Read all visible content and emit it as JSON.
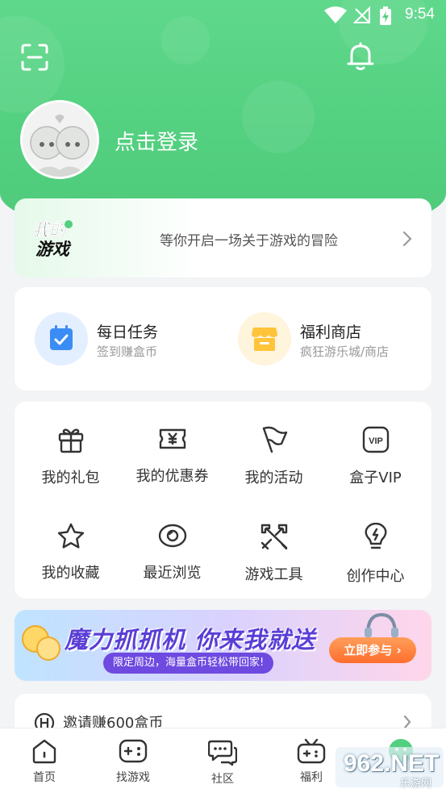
{
  "status_bar": {
    "time": "9:54"
  },
  "profile": {
    "login_text": "点击登录"
  },
  "adventure": {
    "logo_text_1": "我的",
    "logo_text_2": "游戏",
    "text": "等你开启一场关于游戏的冒险"
  },
  "tasks": [
    {
      "title": "每日任务",
      "subtitle": "签到赚盒币",
      "icon": "calendar-check-icon"
    },
    {
      "title": "福利商店",
      "subtitle": "疯狂游乐城/商店",
      "icon": "shop-icon"
    }
  ],
  "grid": [
    {
      "label": "我的礼包",
      "icon": "gift-icon"
    },
    {
      "label": "我的优惠券",
      "icon": "coupon-icon"
    },
    {
      "label": "我的活动",
      "icon": "flag-icon"
    },
    {
      "label": "盒子VIP",
      "icon": "vip-icon"
    },
    {
      "label": "我的收藏",
      "icon": "star-icon"
    },
    {
      "label": "最近浏览",
      "icon": "eye-icon"
    },
    {
      "label": "游戏工具",
      "icon": "tools-icon"
    },
    {
      "label": "创作中心",
      "icon": "bulb-icon"
    }
  ],
  "banner": {
    "title": "魔力抓抓机 你来我就送",
    "subtitle": "限定周边，海量盒币轻松带回家!",
    "button": "立即参与 ›"
  },
  "invite": {
    "text": "邀请赚600盒币"
  },
  "tabs": [
    {
      "label": "首页",
      "icon": "home-icon"
    },
    {
      "label": "找游戏",
      "icon": "gamepad-icon"
    },
    {
      "label": "社区",
      "icon": "chat-icon"
    },
    {
      "label": "福利",
      "icon": "gift-tv-icon"
    }
  ],
  "watermark": {
    "text": "962.NET",
    "sub": "乐游网"
  },
  "colors": {
    "accent": "#52cf7f",
    "coin_orange": "#ffc43a",
    "task_blue": "#3b8cf5"
  }
}
